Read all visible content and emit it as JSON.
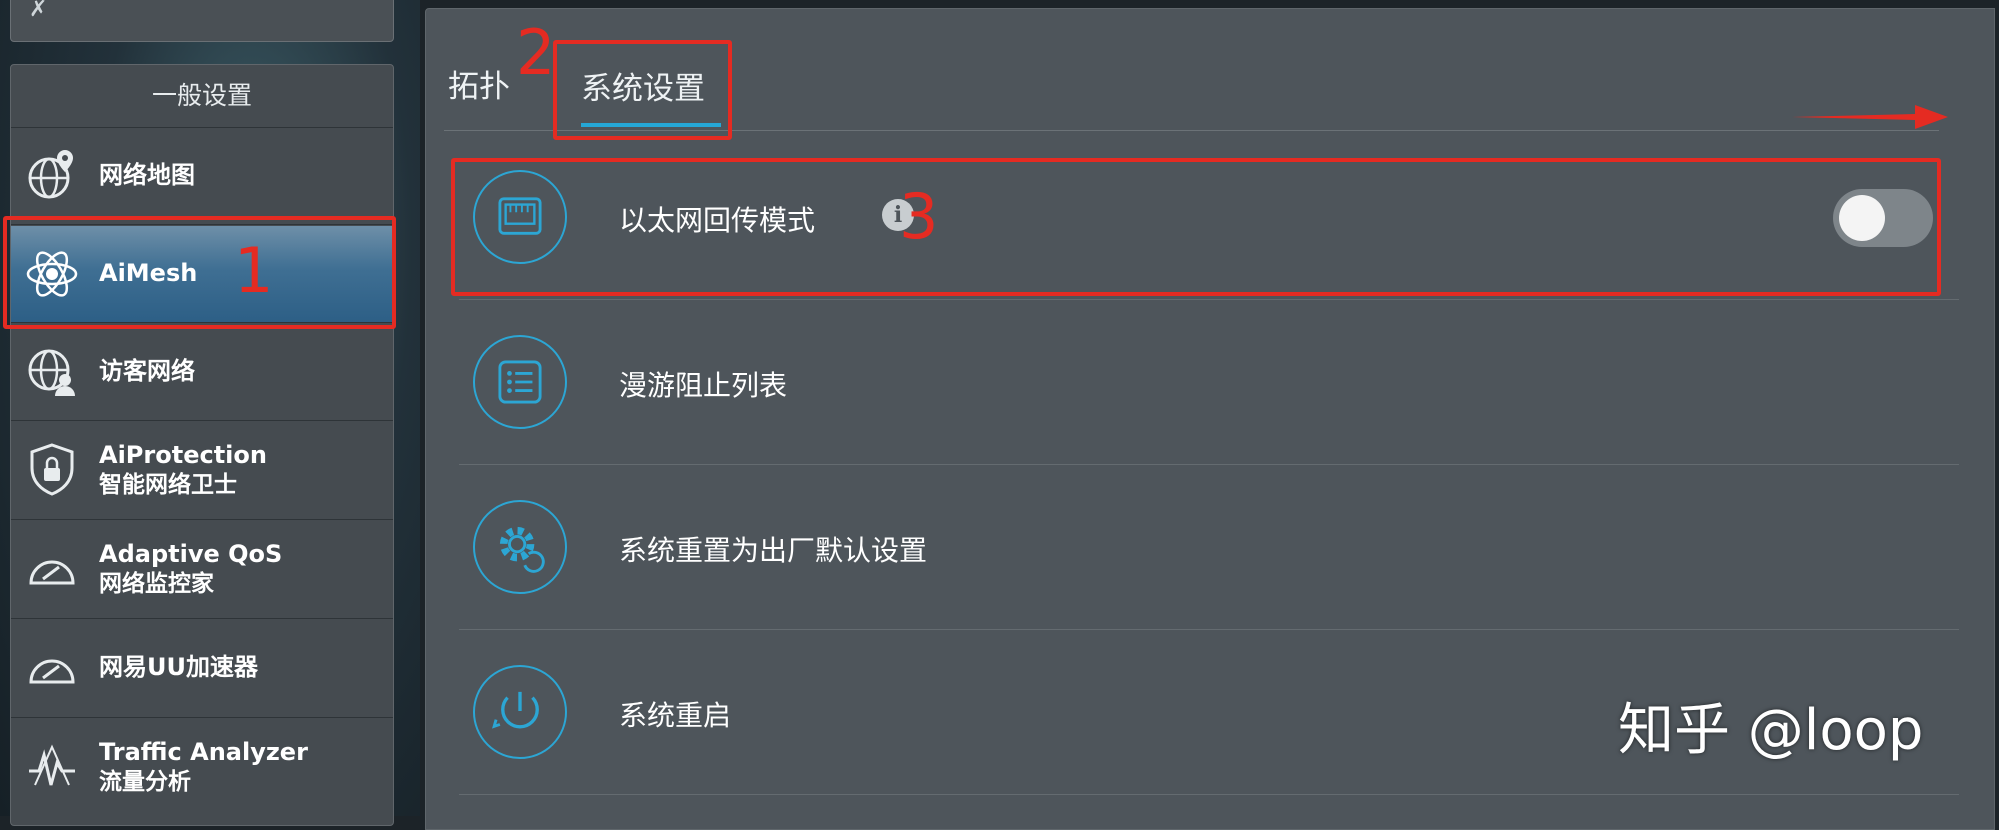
{
  "sidebar": {
    "header": "一般设置",
    "items": [
      {
        "label": "网络地图",
        "sub": ""
      },
      {
        "label": "AiMesh",
        "sub": ""
      },
      {
        "label": "访客网络",
        "sub": ""
      },
      {
        "label": "AiProtection",
        "sub": "智能网络卫士"
      },
      {
        "label": "Adaptive QoS",
        "sub": "网络监控家"
      },
      {
        "label": "网易UU加速器",
        "sub": ""
      },
      {
        "label": "Traffic Analyzer",
        "sub": "流量分析"
      }
    ]
  },
  "tabs": [
    {
      "label": "拓扑"
    },
    {
      "label": "系统设置"
    }
  ],
  "settings": [
    {
      "label": "以太网回传模式",
      "icon": "ethernet-port-icon",
      "toggle": "off"
    },
    {
      "label": "漫游阻止列表",
      "icon": "list-icon"
    },
    {
      "label": "系统重置为出厂默认设置",
      "icon": "gear-reset-icon"
    },
    {
      "label": "系统重启",
      "icon": "power-restart-icon"
    }
  ],
  "annotations": {
    "one": "1",
    "two": "2",
    "three": "3"
  },
  "watermark": "知乎 @loop",
  "colors": {
    "accent": "#25a7d6",
    "annotation": "#e52b22",
    "panel": "#4e555b"
  }
}
